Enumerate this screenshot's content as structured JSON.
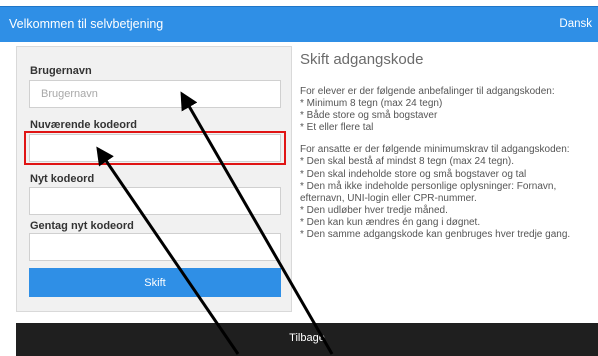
{
  "header": {
    "title": "Velkommen til selvbetjening",
    "language": "Dansk"
  },
  "form": {
    "username_label": "Brugernavn",
    "username_placeholder": "Brugernavn",
    "username_value": "",
    "current_password_label": "Nuværende kodeord",
    "current_password_value": "",
    "new_password_label": "Nyt kodeord",
    "new_password_value": "",
    "repeat_password_label": "Gentag nyt kodeord",
    "repeat_password_value": "",
    "submit_label": "Skift"
  },
  "info": {
    "heading": "Skift adgangskode",
    "students_text": "For elever er der følgende anbefalinger til adgangskoden:\n* Minimum 8 tegn (max 24 tegn)\n* Både store og små bogstaver\n* Et eller flere tal",
    "staff_text": "For ansatte er der følgende minimumskrav til adgangskoden:\n* Den skal bestå af mindst 8 tegn (max 24 tegn).\n* Den skal indeholde store og små bogstaver og tal\n* Den må ikke indeholde personlige oplysninger: Fornavn, efternavn, UNI-login eller CPR-nummer.\n* Den udløber hver tredje måned.\n* Den kan kun ændres én gang i døgnet.\n* Den samme adgangskode kan genbruges hver tredje gang."
  },
  "footer": {
    "back_label": "Tilbage"
  },
  "colors": {
    "primary": "#2f8fe6",
    "highlight": "#e01414",
    "footer": "#1f1f1f"
  }
}
